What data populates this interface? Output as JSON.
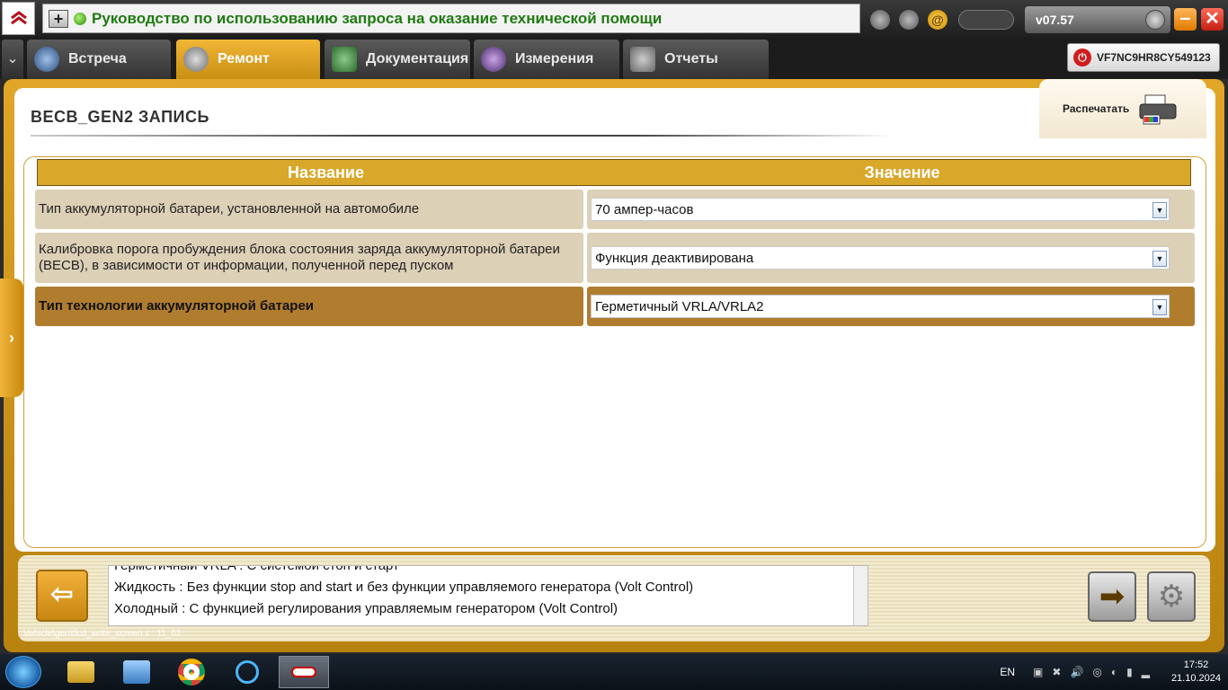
{
  "window": {
    "title": "Руководство по использованию запроса на оказание технической помощи",
    "version": "v07.57",
    "vin": "VF7NC9HR8CY549123"
  },
  "tabs": [
    {
      "label": "Встреча",
      "active": false
    },
    {
      "label": "Ремонт",
      "active": true
    },
    {
      "label": "Документация",
      "active": false
    },
    {
      "label": "Измерения",
      "active": false
    },
    {
      "label": "Отчеты",
      "active": false
    }
  ],
  "page": {
    "title": "BECB_GEN2  ЗАПИСЬ",
    "print_label": "Распечатать"
  },
  "table": {
    "headers": [
      "Название",
      "Значение"
    ],
    "rows": [
      {
        "name": "Тип аккумуляторной батареи, установленной на автомобиле",
        "value": "70 ампер-часов",
        "selected": false
      },
      {
        "name": "Калибровка порога пробуждения блока состояния заряда аккумуляторной батареи (BECB), в зависимости от информации, полученной перед пуском",
        "value": "Функция деактивирована",
        "selected": false
      },
      {
        "name": "Тип технологии аккумуляторной батареи",
        "value": "Герметичный VRLA/VRLA2",
        "selected": true
      }
    ]
  },
  "info": {
    "lines": [
      "Герметичный VRLA : С системой стоп и старт",
      "Жидкость : Без функции stop and start и без функции управляемого генератора (Volt Control)",
      "Холодный : С функцией регулирования управляемым генератором (Volt Control)"
    ]
  },
  "status_path": "Vehicle\\gen\\tlcd_write_screen.s : 11_02",
  "taskbar": {
    "lang": "EN",
    "time": "17:52",
    "date": "21.10.2024"
  },
  "colors": {
    "accent": "#d9a72a",
    "title_green": "#1f7a12",
    "selected_row": "#b07d2f"
  }
}
